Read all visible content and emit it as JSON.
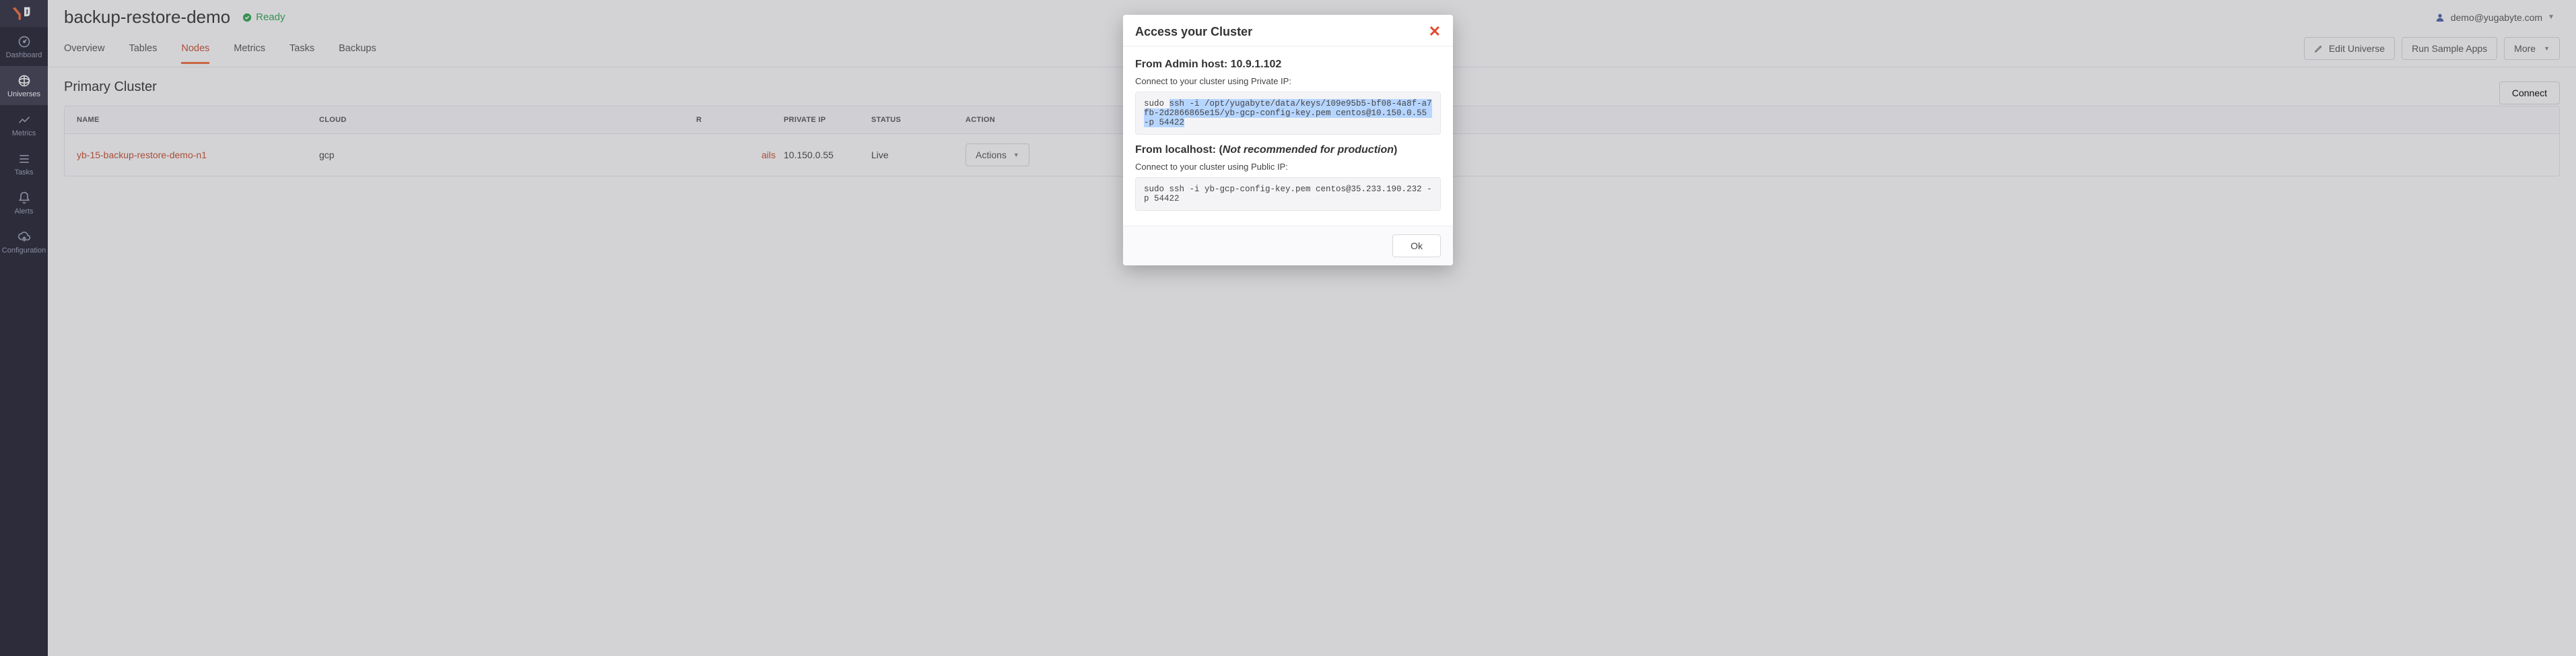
{
  "sidebar": {
    "items": [
      {
        "label": "Dashboard"
      },
      {
        "label": "Universes"
      },
      {
        "label": "Metrics"
      },
      {
        "label": "Tasks"
      },
      {
        "label": "Alerts"
      },
      {
        "label": "Configuration"
      }
    ]
  },
  "header": {
    "universe_name": "backup-restore-demo",
    "status": "Ready",
    "user_email": "demo@yugabyte.com"
  },
  "tabs": {
    "items": [
      {
        "label": "Overview"
      },
      {
        "label": "Tables"
      },
      {
        "label": "Nodes"
      },
      {
        "label": "Metrics"
      },
      {
        "label": "Tasks"
      },
      {
        "label": "Backups"
      }
    ],
    "buttons": {
      "edit": "Edit Universe",
      "sample": "Run Sample Apps",
      "more": "More"
    }
  },
  "nodes": {
    "section_title": "Primary Cluster",
    "connect_label": "Connect",
    "columns": {
      "name": "NAME",
      "cloud": "CLOUD",
      "peek_r": "R",
      "private_ip": "PRIVATE IP",
      "status": "STATUS",
      "action": "ACTION"
    },
    "rows": [
      {
        "name": "yb-15-backup-restore-demo-n1",
        "cloud": "gcp",
        "peek_r": "ails",
        "private_ip": "10.150.0.55",
        "status": "Live",
        "action_label": "Actions"
      }
    ]
  },
  "modal": {
    "title": "Access your Cluster",
    "section1_title_prefix": "From Admin host: ",
    "section1_title_value": "10.9.1.102",
    "section1_sub": "Connect to your cluster using Private IP:",
    "section1_cmd_prefix": "sudo ",
    "section1_cmd_hl": "ssh -i /opt/yugabyte/data/keys/109e95b5-bf08-4a8f-a7fb-2d2866865e15/yb-gcp-config-key.pem centos@10.150.0.55 -p 54422",
    "section2_title_prefix": "From localhost: (",
    "section2_title_italic": "Not recommended for production",
    "section2_title_suffix": ")",
    "section2_sub": "Connect to your cluster using Public IP:",
    "section2_cmd": "sudo ssh -i yb-gcp-config-key.pem centos@35.233.190.232 -p 54422",
    "ok": "Ok"
  },
  "colors": {
    "accent_orange": "#f26d3b",
    "status_green": "#2fa84f",
    "sidebar_bg": "#202030"
  }
}
